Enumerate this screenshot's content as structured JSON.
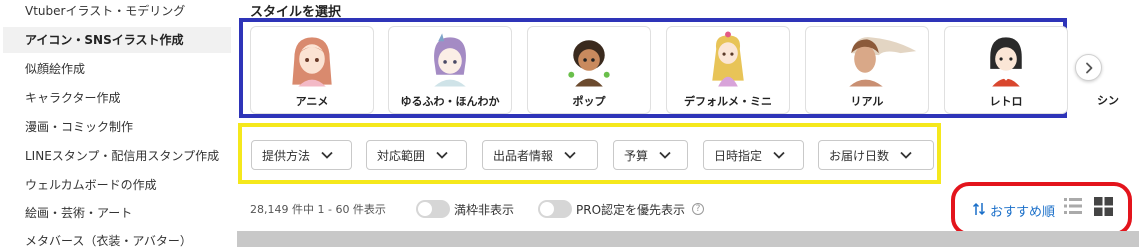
{
  "sidebar": {
    "items": [
      {
        "label": "Vtuberイラスト・モデリング",
        "active": false
      },
      {
        "label": "アイコン・SNSイラスト作成",
        "active": true
      },
      {
        "label": "似顔絵作成",
        "active": false
      },
      {
        "label": "キャラクター作成",
        "active": false
      },
      {
        "label": "漫画・コミック制作",
        "active": false
      },
      {
        "label": "LINEスタンプ・配信用スタンプ作成",
        "active": false
      },
      {
        "label": "ウェルカムボードの作成",
        "active": false
      },
      {
        "label": "絵画・芸術・アート",
        "active": false
      },
      {
        "label": "メタバース（衣装・アバター）",
        "active": false
      }
    ]
  },
  "style_section": {
    "title": "スタイルを選択",
    "styles": [
      {
        "label": "アニメ",
        "icon": "anime-style-illustration"
      },
      {
        "label": "ゆるふわ・ほんわか",
        "icon": "soft-fluffy-style-illustration"
      },
      {
        "label": "ポップ",
        "icon": "pop-style-illustration"
      },
      {
        "label": "デフォルメ・ミニ",
        "icon": "chibi-style-illustration"
      },
      {
        "label": "リアル",
        "icon": "realistic-style-illustration"
      },
      {
        "label": "レトロ",
        "icon": "retro-style-illustration"
      }
    ],
    "partial_label": "シン",
    "next_icon": "chevron-right-icon"
  },
  "filters": [
    {
      "label": "提供方法"
    },
    {
      "label": "対応範囲"
    },
    {
      "label": "出品者情報"
    },
    {
      "label": "予算"
    },
    {
      "label": "日時指定"
    },
    {
      "label": "お届け日数"
    }
  ],
  "results": {
    "count_text": "28,149 件中 1 - 60 件表示",
    "toggle_full": {
      "label": "満枠非表示",
      "on": false
    },
    "toggle_pro": {
      "label": "PRO認定を優先表示",
      "on": false
    },
    "help_glyph": "?"
  },
  "sort": {
    "label": "おすすめ順",
    "list_view_icon": "list-view-icon",
    "grid_view_icon": "grid-view-icon"
  },
  "colors": {
    "blue_frame": "#2e34b8",
    "yellow_frame": "#f5e81c",
    "red_frame": "#e3141c",
    "link": "#1a6fc9",
    "active_bg": "#f1f1f1"
  }
}
